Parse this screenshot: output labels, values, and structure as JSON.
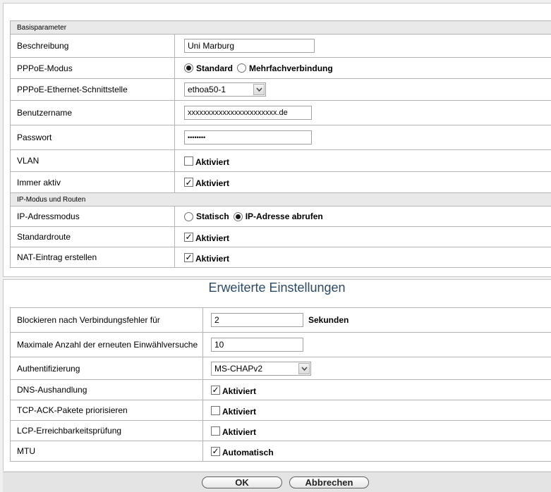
{
  "basis": {
    "header": "Basisparameter",
    "description": {
      "label": "Beschreibung",
      "value": "Uni Marburg"
    },
    "pppoe_mode": {
      "label": "PPPoE-Modus",
      "option1": "Standard",
      "option2": "Mehrfachverbindung",
      "selected": "Standard"
    },
    "interface": {
      "label": "PPPoE-Ethernet-Schnittstelle",
      "value": "ethoa50-1"
    },
    "username": {
      "label": "Benutzername",
      "value": "xxxxxxxxxxxxxxxxxxxxxxx.de"
    },
    "password": {
      "label": "Passwort",
      "value": "••••••••"
    },
    "vlan": {
      "label": "VLAN",
      "checkbox_label": "Aktiviert",
      "checked": false
    },
    "always_on": {
      "label": "Immer aktiv",
      "checkbox_label": "Aktiviert",
      "checked": true
    }
  },
  "ip": {
    "header": "IP-Modus und Routen",
    "mode": {
      "label": "IP-Adressmodus",
      "option1": "Statisch",
      "option2": "IP-Adresse abrufen",
      "selected": "IP-Adresse abrufen"
    },
    "default_route": {
      "label": "Standardroute",
      "checkbox_label": "Aktiviert",
      "checked": true
    },
    "nat": {
      "label": "NAT-Eintrag erstellen",
      "checkbox_label": "Aktiviert",
      "checked": true
    }
  },
  "advanced": {
    "title": "Erweiterte Einstellungen",
    "block": {
      "label": "Blockieren nach Verbindungsfehler für",
      "value": "2",
      "unit": "Sekunden"
    },
    "redial": {
      "label": "Maximale Anzahl der erneuten Einwählversuche",
      "value": "10"
    },
    "auth": {
      "label": "Authentifizierung",
      "value": "MS-CHAPv2"
    },
    "dns": {
      "label": "DNS-Aushandlung",
      "checkbox_label": "Aktiviert",
      "checked": true
    },
    "tcp_ack": {
      "label": "TCP-ACK-Pakete priorisieren",
      "checkbox_label": "Aktiviert",
      "checked": false
    },
    "lcp": {
      "label": "LCP-Erreichbarkeitsprüfung",
      "checkbox_label": "Aktiviert",
      "checked": false
    },
    "mtu": {
      "label": "MTU",
      "checkbox_label": "Automatisch",
      "checked": true
    }
  },
  "buttons": {
    "ok": "OK",
    "cancel": "Abbrechen"
  }
}
